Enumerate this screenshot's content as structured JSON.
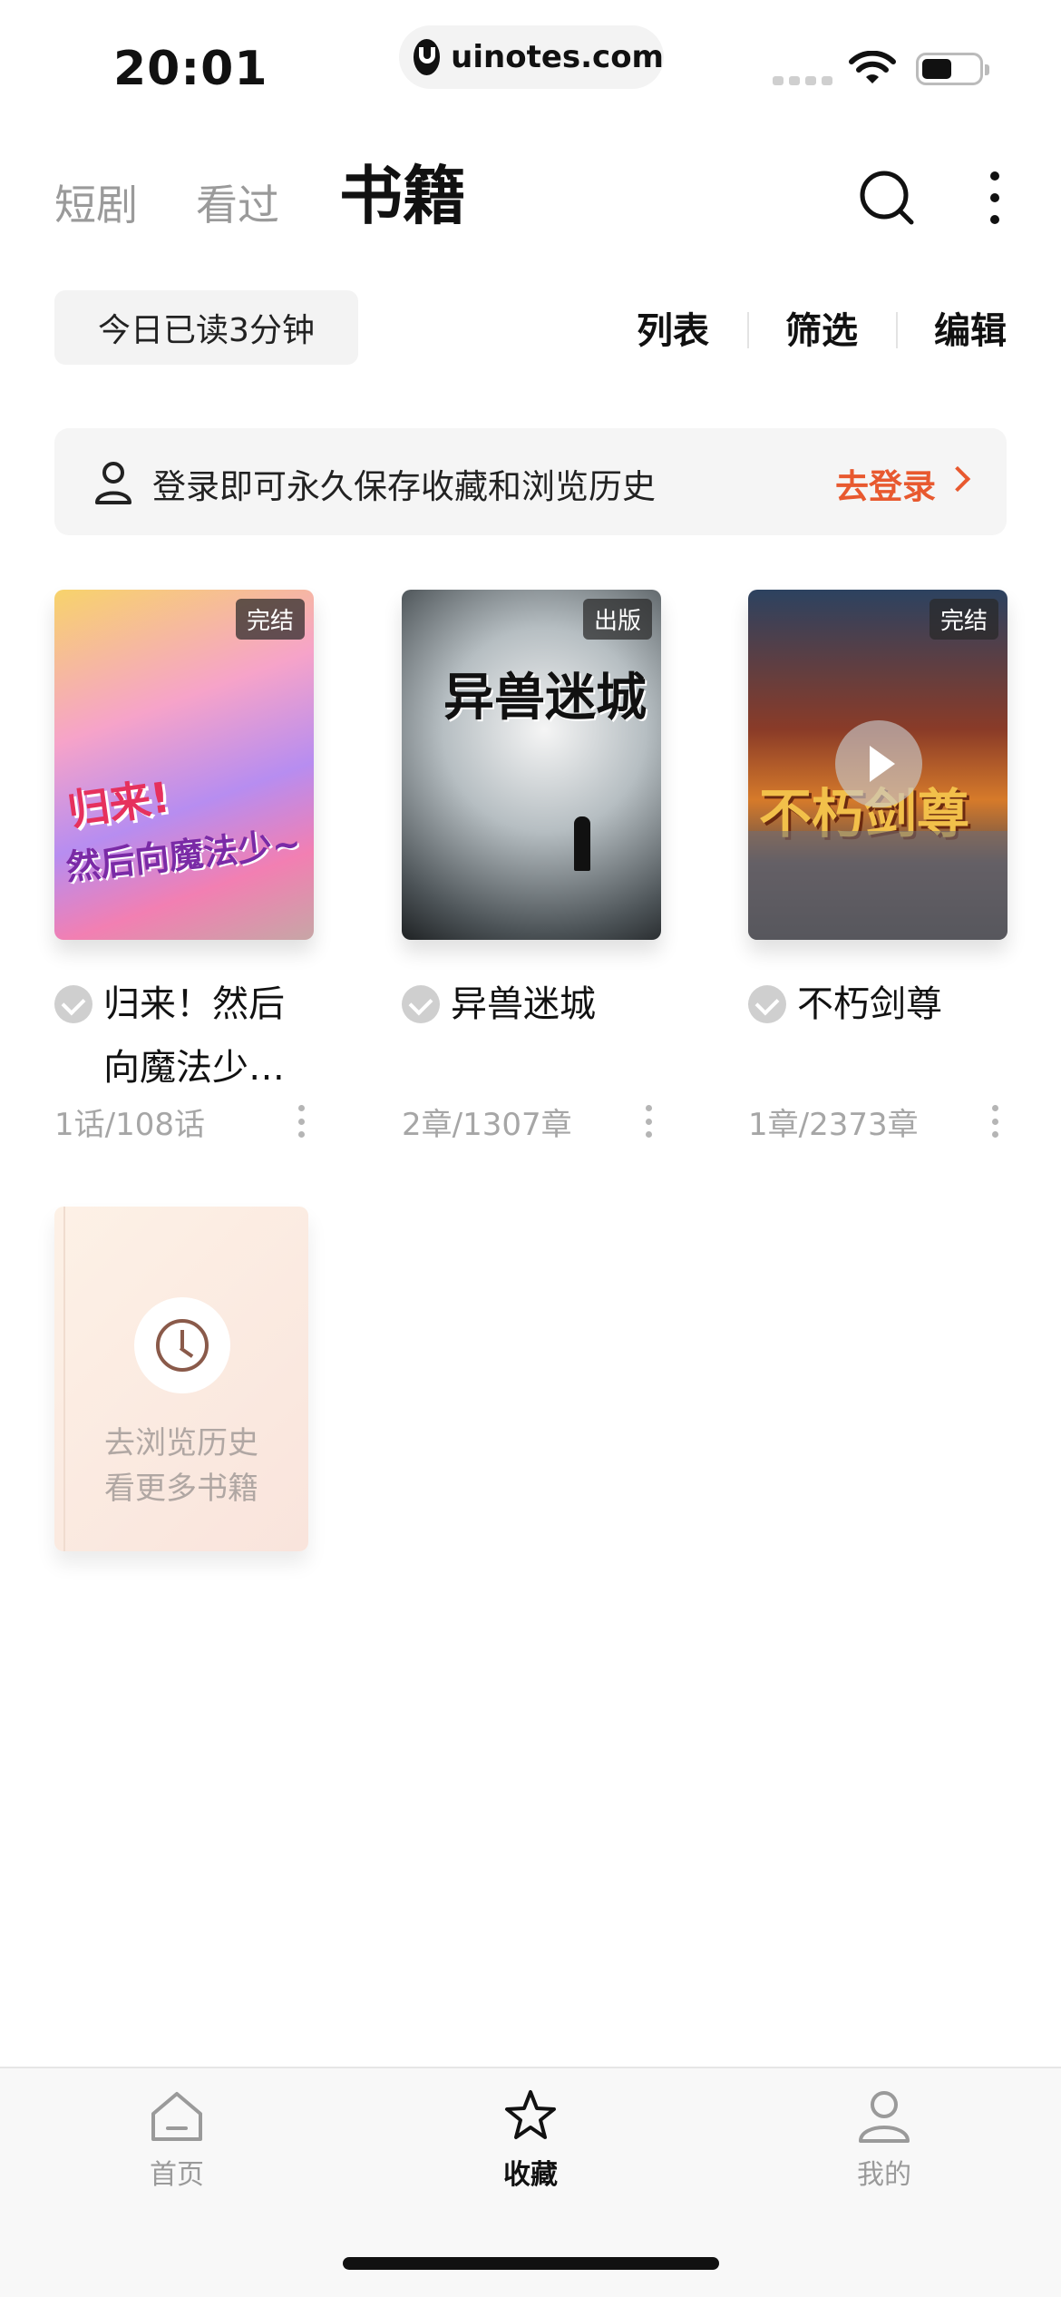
{
  "status_bar": {
    "time": "20:01",
    "url": "uinotes.com"
  },
  "header": {
    "tabs": [
      {
        "label": "短剧"
      },
      {
        "label": "看过"
      },
      {
        "label": "书籍"
      }
    ],
    "active_tab": "书籍"
  },
  "toolbar": {
    "read_today": "今日已读3分钟",
    "actions": [
      {
        "label": "列表"
      },
      {
        "label": "筛选"
      },
      {
        "label": "编辑"
      }
    ]
  },
  "login_banner": {
    "text": "登录即可永久保存收藏和浏览历史",
    "link": "去登录"
  },
  "books": [
    {
      "title": "归来！然后向魔法少女…",
      "badge": "完结",
      "progress": "1话/108话",
      "cover_title": "归来!",
      "cover_sub": "然后向魔法少~"
    },
    {
      "title": "异兽迷城",
      "badge": "出版",
      "progress": "2章/1307章",
      "cover_title": "异兽迷城"
    },
    {
      "title": "不朽剑尊",
      "badge": "完结",
      "progress": "1章/2373章",
      "cover_title": "不朽剑尊"
    }
  ],
  "history_card": {
    "line1": "去浏览历史",
    "line2": "看更多书籍"
  },
  "bottom_nav": [
    {
      "label": "首页",
      "icon": "home-icon"
    },
    {
      "label": "收藏",
      "icon": "star-icon",
      "active": true
    },
    {
      "label": "我的",
      "icon": "person-icon"
    }
  ],
  "colors": {
    "accent": "#e8592f",
    "text": "#111111",
    "muted": "#9a9a9a"
  }
}
